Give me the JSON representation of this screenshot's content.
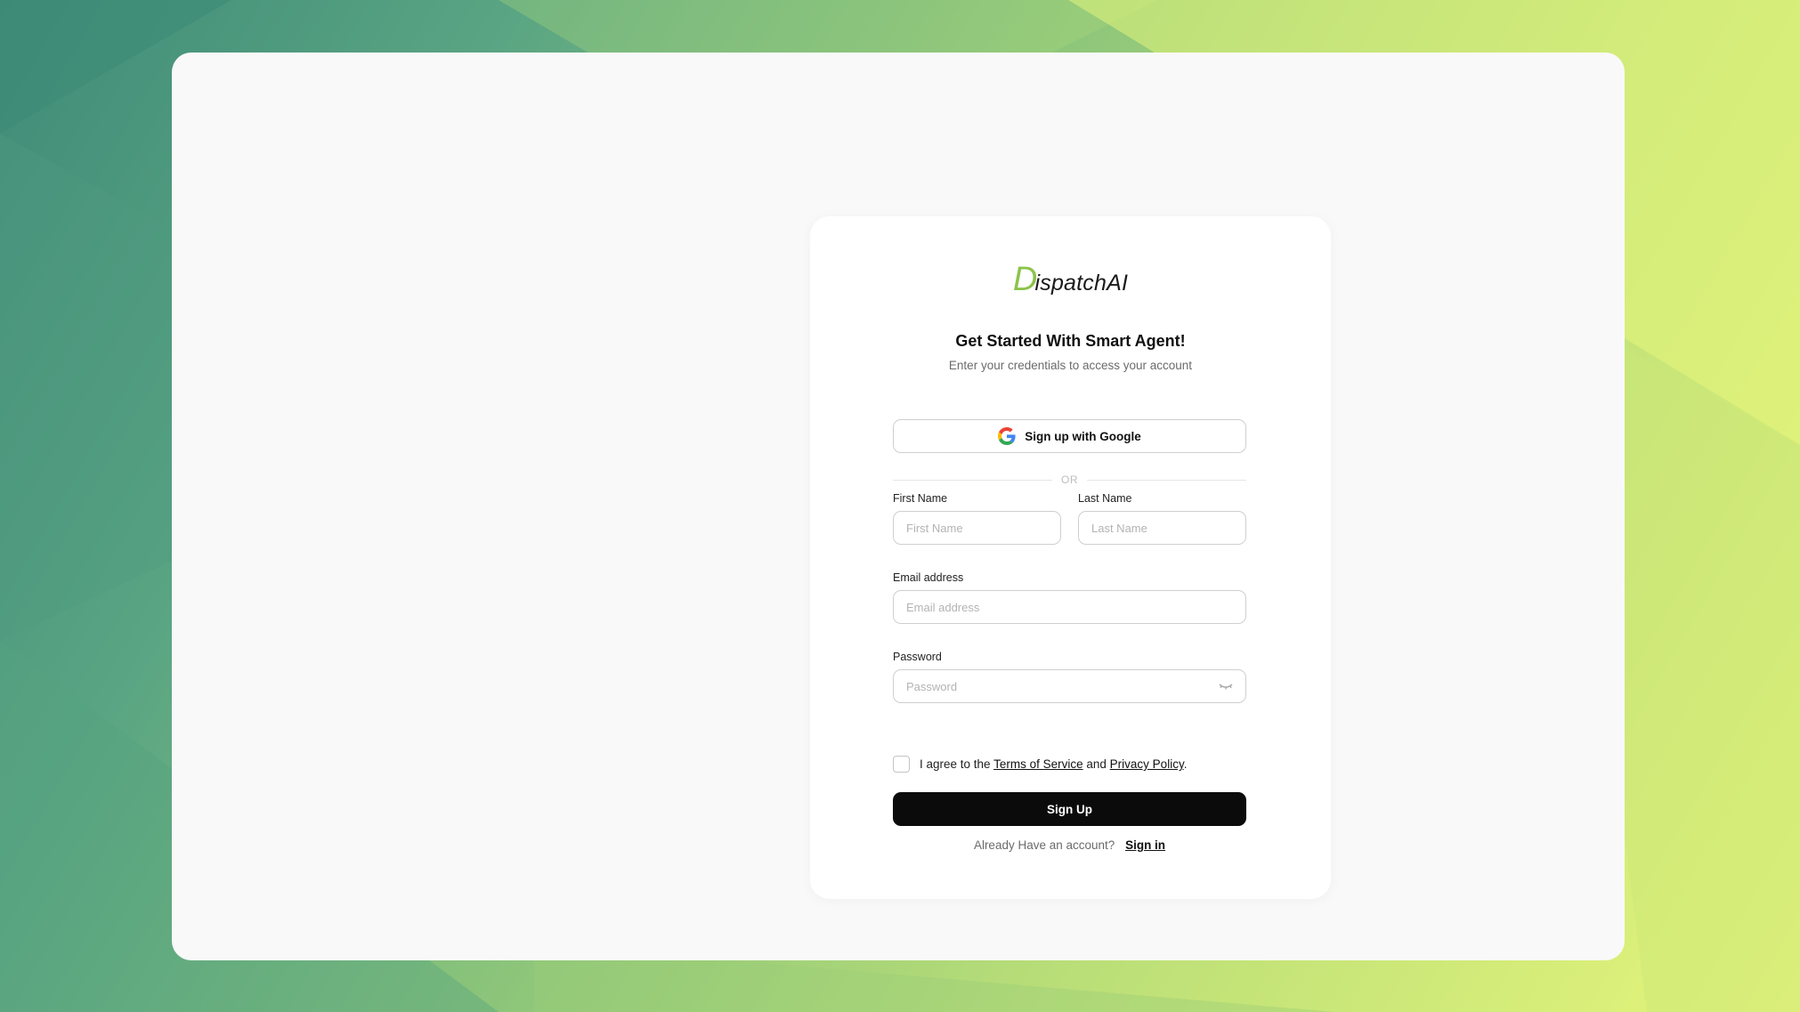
{
  "brand": {
    "logo_mark": "D",
    "logo_text": "ispatchAI",
    "accent_color": "#8cc34a"
  },
  "heading": {
    "title": "Get Started With Smart Agent!",
    "subtitle": "Enter your credentials to access your account"
  },
  "google": {
    "label": "Sign up with Google",
    "icon": "google-icon"
  },
  "divider": {
    "text": "OR"
  },
  "fields": {
    "first_name": {
      "label": "First Name",
      "placeholder": "First Name",
      "value": ""
    },
    "last_name": {
      "label": "Last Name",
      "placeholder": "Last Name",
      "value": ""
    },
    "email": {
      "label": "Email address",
      "placeholder": "Email address",
      "value": ""
    },
    "password": {
      "label": "Password",
      "placeholder": "Password",
      "value": "",
      "toggle_icon": "eye-closed-icon"
    }
  },
  "agreement": {
    "prefix": "I agree to the",
    "terms": "Terms of Service",
    "and": "and",
    "privacy": "Privacy Policy",
    "suffix": ".",
    "checked": false
  },
  "actions": {
    "signup_label": "Sign Up",
    "signin_prompt": "Already Have an account?",
    "signin_label": "Sign in"
  }
}
